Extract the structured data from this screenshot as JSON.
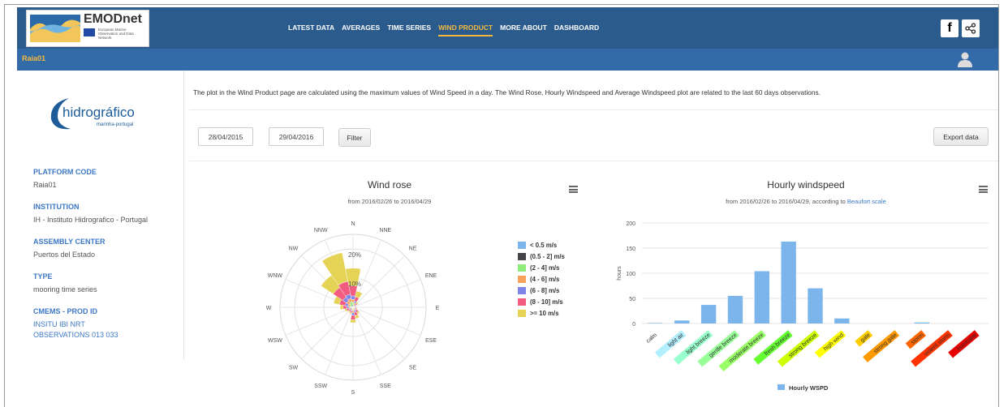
{
  "header": {
    "logo_name": "EMODnet",
    "logo_sub": "European Marine Observation and Data Network",
    "nav": [
      {
        "label": "LATEST DATA",
        "active": false
      },
      {
        "label": "AVERAGES",
        "active": false
      },
      {
        "label": "TIME SERIES",
        "active": false
      },
      {
        "label": "WIND PRODUCT",
        "active": true
      },
      {
        "label": "MORE ABOUT",
        "active": false
      },
      {
        "label": "DASHBOARD",
        "active": false
      }
    ],
    "facebook_label": "f",
    "icons": {
      "facebook": "facebook-icon",
      "share": "share-icon",
      "user": "user-icon",
      "hamburger": "menu-icon"
    },
    "accent_color": "#f3b93c"
  },
  "subbar": {
    "station": "Raia01"
  },
  "sidebar": {
    "logo_text": "hidrográfico",
    "logo_sub": "marinha-portugal",
    "fields": [
      {
        "label": "PLATFORM CODE",
        "value": "Raia01",
        "link": false
      },
      {
        "label": "INSTITUTION",
        "value": "IH - Instituto Hidrografico - Portugal",
        "link": false
      },
      {
        "label": "ASSEMBLY CENTER",
        "value": "Puertos del Estado",
        "link": false
      },
      {
        "label": "TYPE",
        "value": "mooring time series",
        "link": false
      },
      {
        "label": "CMEMS - PROD ID",
        "value": "INSITU IBI NRT OBSERVATIONS 013 033",
        "link": true
      }
    ]
  },
  "main": {
    "description": "The plot in the Wind Product page are calculated using the maximum values of Wind Speed in a day. The Wind Rose, Hourly Windspeed and Average Windspeed plot are related to the last 60 days observations.",
    "date_from": "28/04/2015",
    "date_to": "29/04/2016",
    "filter_label": "Filter",
    "export_label": "Export data"
  },
  "chart_data": [
    {
      "type": "polar-bar",
      "title": "Wind rose",
      "subtitle": "from 2016/02/26 to 2016/04/29",
      "directions": [
        "N",
        "NNE",
        "NE",
        "ENE",
        "E",
        "ESE",
        "SE",
        "SSE",
        "S",
        "SSW",
        "SW",
        "WSW",
        "W",
        "WNW",
        "NW",
        "NNW"
      ],
      "radial_ticks": [
        "10%",
        "20%"
      ],
      "radial_max": 25,
      "series": [
        {
          "name": "< 0.5 m/s",
          "color": "#7cb5ec",
          "values": [
            0.4,
            0.2,
            0.1,
            0.1,
            0.1,
            0.1,
            0.1,
            0.1,
            0.2,
            0.1,
            0.1,
            0.1,
            0.2,
            0.2,
            0.3,
            0.4
          ]
        },
        {
          "name": "(0.5 - 2] m/s",
          "color": "#434348",
          "values": [
            0.5,
            0.3,
            0.2,
            0.1,
            0.2,
            0.1,
            0.2,
            0.2,
            0.3,
            0.2,
            0.2,
            0.2,
            0.3,
            0.3,
            0.4,
            0.5
          ]
        },
        {
          "name": "(2 - 4] m/s",
          "color": "#90ed7d",
          "values": [
            0.8,
            0.5,
            0.3,
            0.2,
            0.2,
            0.2,
            0.3,
            0.4,
            0.6,
            0.3,
            0.3,
            0.3,
            0.4,
            0.5,
            0.8,
            1.0
          ]
        },
        {
          "name": "(4 - 6] m/s",
          "color": "#f7a35c",
          "values": [
            1.0,
            0.6,
            0.3,
            0.2,
            0.2,
            0.2,
            0.4,
            0.5,
            0.8,
            0.4,
            0.3,
            0.4,
            0.6,
            0.8,
            1.2,
            1.2
          ]
        },
        {
          "name": "(6 - 8] m/s",
          "color": "#8085e9",
          "values": [
            1.2,
            0.6,
            0.3,
            0.2,
            0.2,
            0.2,
            0.4,
            0.6,
            0.9,
            0.4,
            0.3,
            0.5,
            0.7,
            1.0,
            1.5,
            1.5
          ]
        },
        {
          "name": "(8 - 10] m/s",
          "color": "#f15c80",
          "values": [
            3.5,
            1.5,
            0.5,
            0.3,
            0.3,
            0.4,
            0.8,
            1.2,
            1.5,
            0.6,
            0.5,
            0.8,
            1.2,
            2.0,
            4.0,
            4.5
          ]
        },
        {
          "name": ">= 10 m/s",
          "color": "#e4d354",
          "values": [
            6.0,
            2.0,
            0.5,
            0.2,
            0.2,
            0.3,
            0.6,
            1.0,
            1.0,
            0.4,
            0.4,
            0.6,
            1.0,
            2.0,
            5.0,
            10.0
          ]
        }
      ]
    },
    {
      "type": "bar",
      "title": "Hourly windspeed",
      "subtitle_text": "from 2016/02/26 to 2016/04/29, according to ",
      "subtitle_link": "Beaufort scale",
      "ylabel": "hours",
      "ylim": [
        0,
        200
      ],
      "yticks": [
        0,
        50,
        100,
        150,
        200
      ],
      "legend": "Hourly WSPD",
      "bar_color": "#7cb5ec",
      "categories": [
        "calm",
        "light air",
        "light breeze",
        "gentle breeze",
        "moderate breeze",
        "fresh breeze",
        "strong breeze",
        "high wind",
        "gale",
        "strong gale",
        "storm",
        "violent storm",
        "hurricane"
      ],
      "category_colors": [
        "#ffffff",
        "#b3f0ff",
        "#99ffcc",
        "#99ff99",
        "#99ff66",
        "#66ff33",
        "#ccff00",
        "#ffff00",
        "#ffcc00",
        "#ff9900",
        "#ff6600",
        "#ff3300",
        "#e60000"
      ],
      "values": [
        1,
        6,
        37,
        55,
        104,
        163,
        70,
        10,
        0,
        0,
        2,
        0,
        0
      ]
    }
  ]
}
